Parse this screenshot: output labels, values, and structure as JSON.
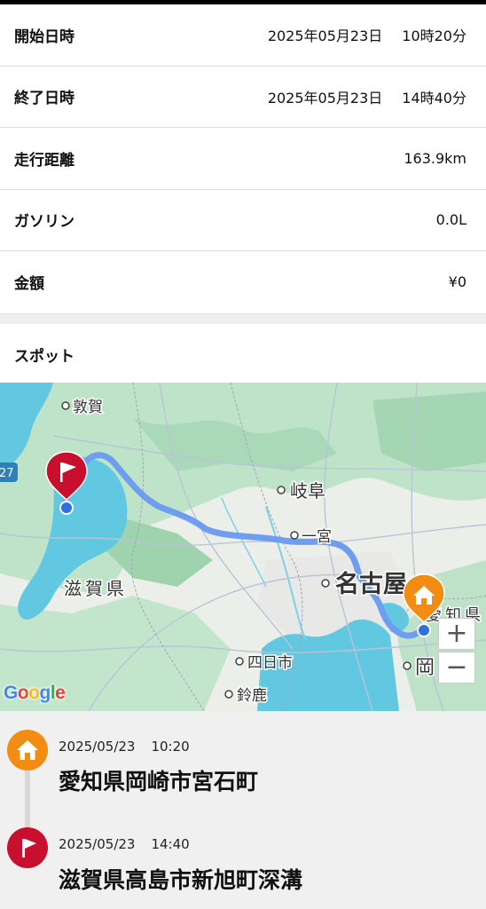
{
  "info": [
    {
      "label": "開始日時",
      "date": "2025年05月23日",
      "time": "10時20分"
    },
    {
      "label": "終了日時",
      "date": "2025年05月23日",
      "time": "14時40分"
    },
    {
      "label": "走行距離",
      "date": "",
      "time": "163.9km"
    },
    {
      "label": "ガソリン",
      "date": "",
      "time": "0.0L"
    },
    {
      "label": "金額",
      "date": "",
      "time": "¥0"
    }
  ],
  "spots_title": "スポット",
  "map": {
    "labels": {
      "tsuruga": "敦賀",
      "gifu": "岐阜",
      "ichinomiya": "一宮",
      "nagoya": "名古屋",
      "shiga": "滋賀県",
      "aichi": "愛知県",
      "yokkaichi": "四日市",
      "suzuka": "鈴鹿",
      "okazaki": "岡",
      "route_shield": "27"
    },
    "zoom_in": "+",
    "zoom_out": "−",
    "logo": "Google",
    "colors": {
      "route": "#6f9ef0",
      "water": "#62c8e2",
      "land": "#b6e0c4",
      "start_marker": "#f28c12",
      "end_marker": "#c8102e"
    }
  },
  "timeline": [
    {
      "icon": "home-icon",
      "date": "2025/05/23",
      "time": "10:20",
      "address": "愛知県岡崎市宮石町"
    },
    {
      "icon": "flag-icon",
      "date": "2025/05/23",
      "time": "14:40",
      "address": "滋賀県高島市新旭町深溝"
    }
  ]
}
